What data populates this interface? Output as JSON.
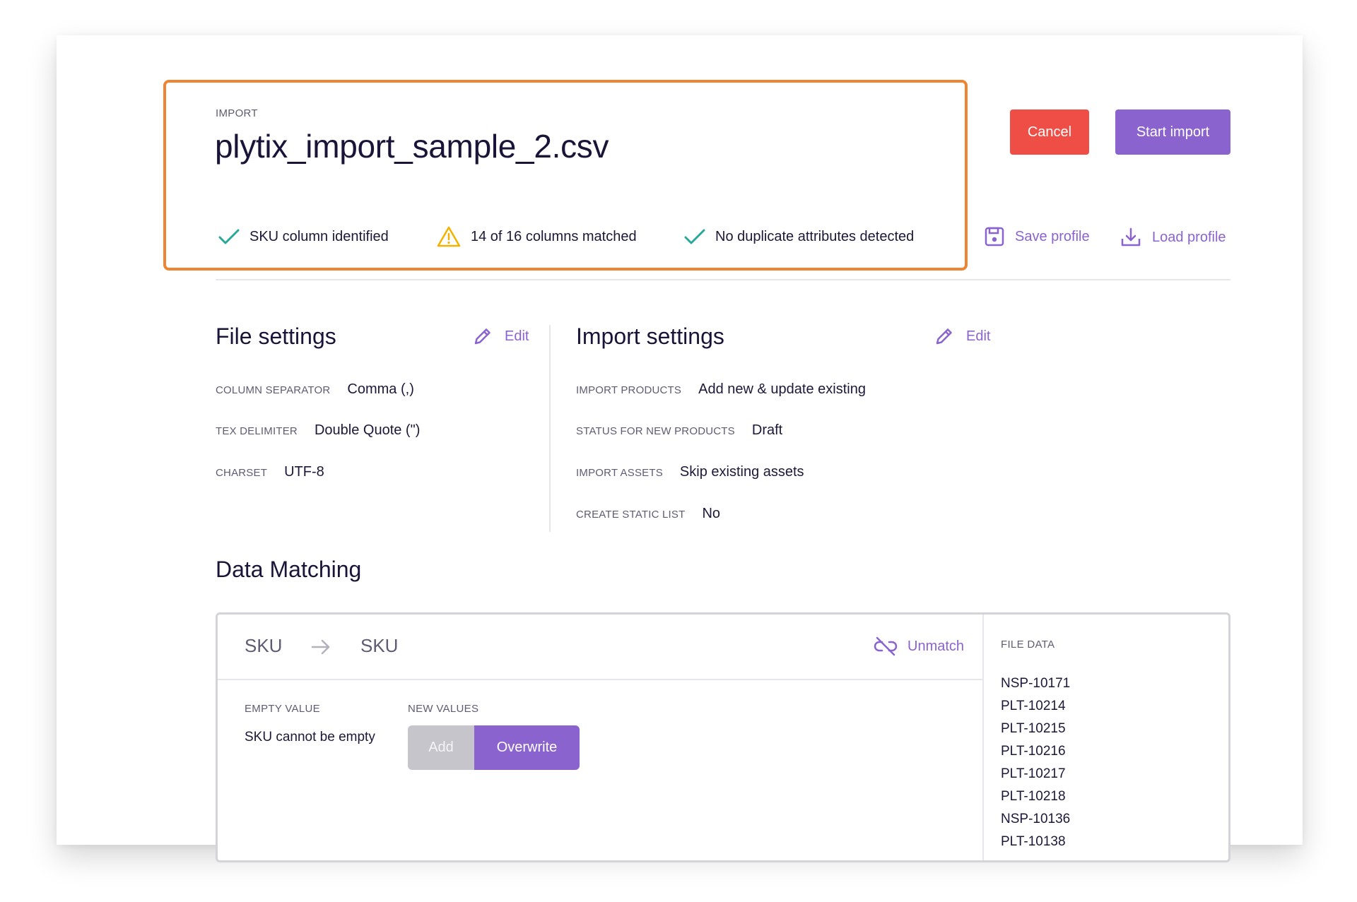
{
  "header": {
    "eyebrow": "IMPORT",
    "file_name": "plytix_import_sample_2.csv",
    "checks": [
      {
        "label": "SKU column identified",
        "status": "ok",
        "icon": "check-icon"
      },
      {
        "label": "14 of 16 columns matched",
        "status": "warning",
        "icon": "warning-icon"
      },
      {
        "label": "No duplicate attributes detected",
        "status": "ok",
        "icon": "check-icon"
      }
    ]
  },
  "actions": {
    "cancel_label": "Cancel",
    "start_label": "Start import",
    "save_profile_label": "Save profile",
    "load_profile_label": "Load profile"
  },
  "file_settings": {
    "title": "File settings",
    "edit_label": "Edit",
    "rows": [
      {
        "key": "COLUMN SEPARATOR",
        "value": "Comma (,)"
      },
      {
        "key": "TEX DELIMITER",
        "value": "Double Quote (\")"
      },
      {
        "key": "CHARSET",
        "value": "UTF-8"
      }
    ]
  },
  "import_settings": {
    "title": "Import settings",
    "edit_label": "Edit",
    "rows": [
      {
        "key": "IMPORT PRODUCTS",
        "value": "Add new & update existing"
      },
      {
        "key": "STATUS FOR NEW PRODUCTS",
        "value": "Draft"
      },
      {
        "key": "IMPORT ASSETS",
        "value": "Skip existing assets"
      },
      {
        "key": "CREATE STATIC LIST",
        "value": "No"
      }
    ]
  },
  "data_matching": {
    "title": "Data Matching",
    "source_column": "SKU",
    "target_attribute": "SKU",
    "unmatch_label": "Unmatch",
    "empty_value_label": "EMPTY VALUE",
    "empty_value_text": "SKU cannot be empty",
    "new_values_label": "NEW VALUES",
    "options": {
      "add": "Add",
      "overwrite": "Overwrite"
    },
    "selected_option": "Overwrite",
    "file_data_label": "FILE DATA",
    "file_data": [
      "NSP-10171",
      "PLT-10214",
      "PLT-10215",
      "PLT-10216",
      "PLT-10217",
      "PLT-10218",
      "NSP-10136",
      "PLT-10138"
    ]
  },
  "colors": {
    "accent": "#8b63cf",
    "danger": "#ee4e45",
    "success": "#2aa79b",
    "warning": "#f2b300",
    "highlight": "#ee8532"
  }
}
